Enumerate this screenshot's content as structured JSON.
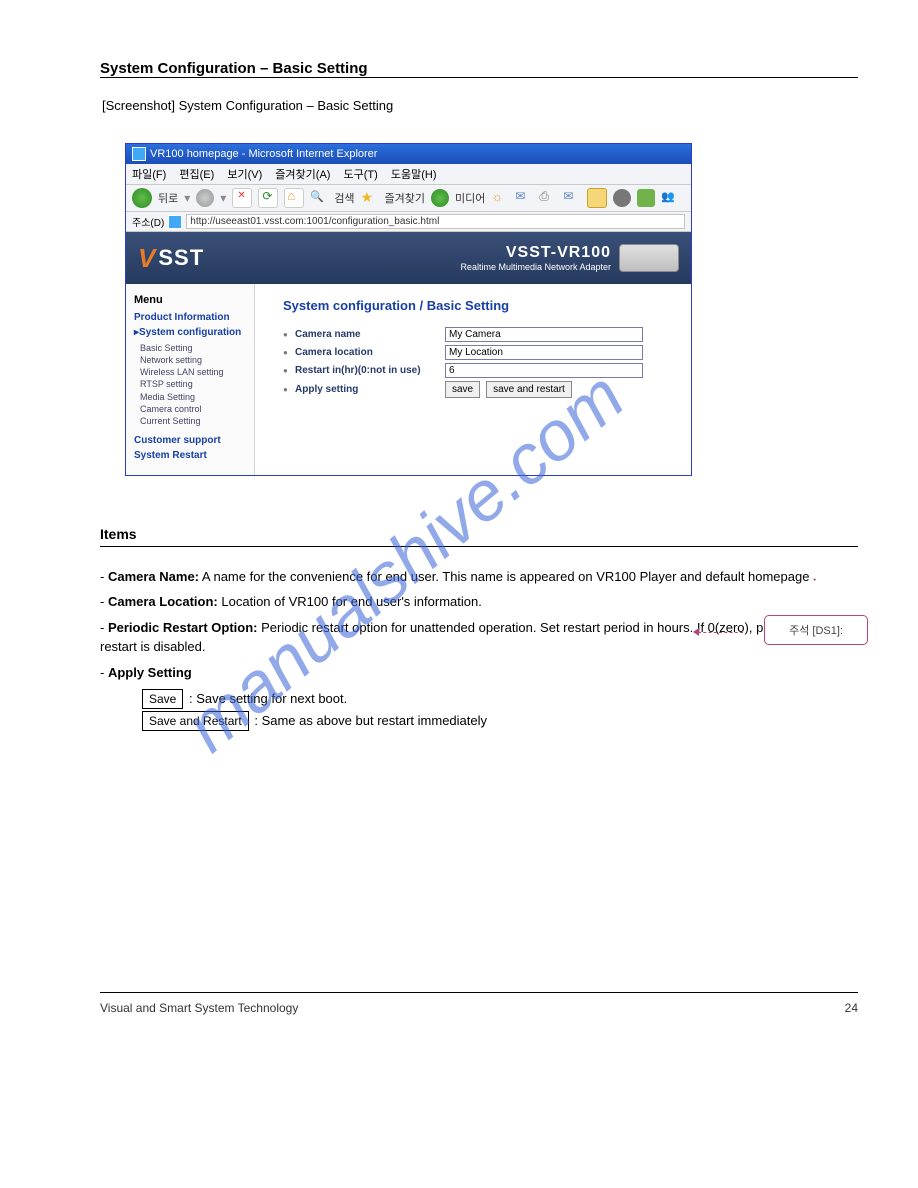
{
  "doc": {
    "heading": "System Configuration – Basic Setting",
    "screenshot_caption_label": "[Screenshot]",
    "screenshot_caption": "System Configuration – Basic Setting",
    "callout": "주석 [DS1]:",
    "section_items_title": "Items",
    "items": {
      "camera_name_lbl": "Camera Name:",
      "camera_name_txt": " A name for the convenience for end user. This name is appeared on VR100 Player and default homepage",
      "camera_loc_lbl": "Camera Location:",
      "camera_loc_txt": " Location of VR100 for end user's information.",
      "periodic_lbl": "Periodic Restart Option:",
      "periodic_txt": " Periodic restart option for unattended operation. Set restart period in hours. If 0(zero), periodic restart is disabled.",
      "apply_lbl": "Apply Setting",
      "save_box": "Save",
      "save_box_txt": ": Save setting for next boot.",
      "save_restart_box": "Save and Restart",
      "save_restart_txt": ": Same as above but restart immediately"
    }
  },
  "ie": {
    "title": "VR100 homepage - Microsoft Internet Explorer",
    "menu": [
      "파일(F)",
      "편집(E)",
      "보기(V)",
      "즐겨찾기(A)",
      "도구(T)",
      "도움말(H)"
    ],
    "back": "뒤로",
    "search": "검색",
    "fav": "즐겨찾기",
    "media": "미디어",
    "addr_lbl": "주소(D)",
    "url": "http://useeast01.vsst.com:1001/configuration_basic.html"
  },
  "banner": {
    "brand1": "V",
    "brand2": "SST",
    "model": "VSST-VR100",
    "tag": "Realtime Multimedia Network Adapter"
  },
  "menu": {
    "heading": "Menu",
    "items": {
      "prodinfo": "Product Information",
      "sysconf": "System configuration",
      "sub": [
        "Basic Setting",
        "Network setting",
        "Wireless LAN setting",
        "RTSP setting",
        "Media Setting",
        "Camera control",
        "Current Setting"
      ],
      "support": "Customer support",
      "restart": "System Restart"
    }
  },
  "form": {
    "title": "System configuration / Basic Setting",
    "rows": {
      "cam_name_lbl": "Camera name",
      "cam_name_val": "My Camera",
      "cam_loc_lbl": "Camera location",
      "cam_loc_val": "My Location",
      "restart_lbl": "Restart in(hr)(0:not in use)",
      "restart_val": "6",
      "apply_lbl": "Apply setting",
      "save_btn": "save",
      "save_restart_btn": "save and restart"
    }
  },
  "footer": {
    "left": "Visual and Smart System Technology",
    "right": "24"
  },
  "watermark": "manualshive.com"
}
